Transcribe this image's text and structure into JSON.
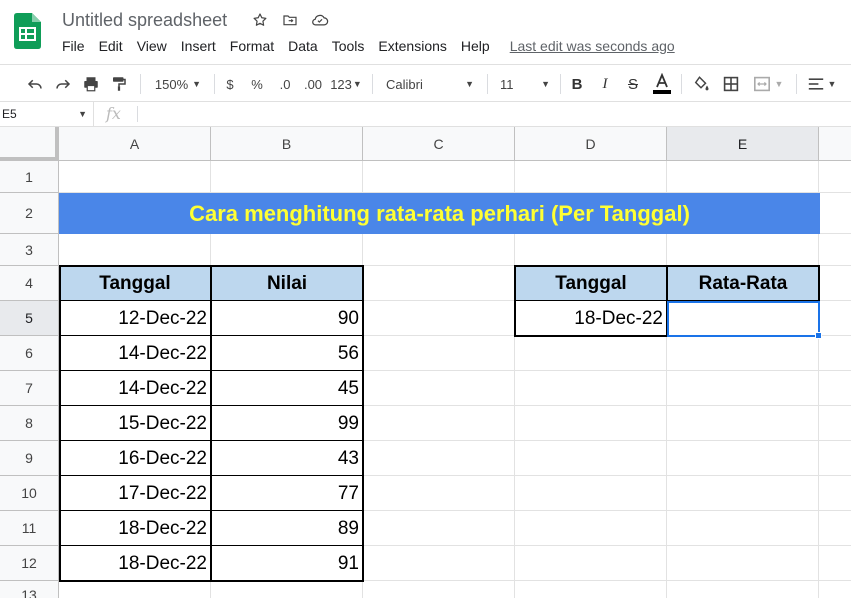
{
  "app": {
    "title": "Untitled spreadsheet",
    "menu": [
      "File",
      "Edit",
      "View",
      "Insert",
      "Format",
      "Data",
      "Tools",
      "Extensions",
      "Help"
    ],
    "last_edit": "Last edit was seconds ago"
  },
  "toolbar": {
    "zoom": "150%",
    "currency": "$",
    "percent": "%",
    "dec_decrease": ".0",
    "dec_increase": ".00",
    "format_more": "123",
    "font": "Calibri",
    "font_size": "11"
  },
  "formula_bar": {
    "name_box": "E5",
    "fx": "fx",
    "value": ""
  },
  "grid": {
    "columns": [
      "A",
      "B",
      "C",
      "D",
      "E"
    ],
    "selected_column": "E",
    "rows": [
      "1",
      "2",
      "3",
      "4",
      "5",
      "6",
      "7",
      "8",
      "9",
      "10",
      "11",
      "12",
      "13"
    ],
    "selected_row": "5"
  },
  "sheet": {
    "banner": "Cara menghitung rata-rata perhari (Per Tanggal)",
    "data_table": {
      "headers": [
        "Tanggal",
        "Nilai"
      ],
      "rows": [
        [
          "12-Dec-22",
          "90"
        ],
        [
          "14-Dec-22",
          "56"
        ],
        [
          "14-Dec-22",
          "45"
        ],
        [
          "15-Dec-22",
          "99"
        ],
        [
          "16-Dec-22",
          "43"
        ],
        [
          "17-Dec-22",
          "77"
        ],
        [
          "18-Dec-22",
          "89"
        ],
        [
          "18-Dec-22",
          "91"
        ]
      ]
    },
    "result_table": {
      "headers": [
        "Tanggal",
        "Rata-Rata"
      ],
      "row": [
        "18-Dec-22",
        ""
      ]
    }
  },
  "colors": {
    "banner_bg": "#4a86e8",
    "banner_text": "#ffff33",
    "header_bg": "#bdd7ee",
    "selection": "#1a73e8",
    "sheets_green": "#0f9d58"
  }
}
